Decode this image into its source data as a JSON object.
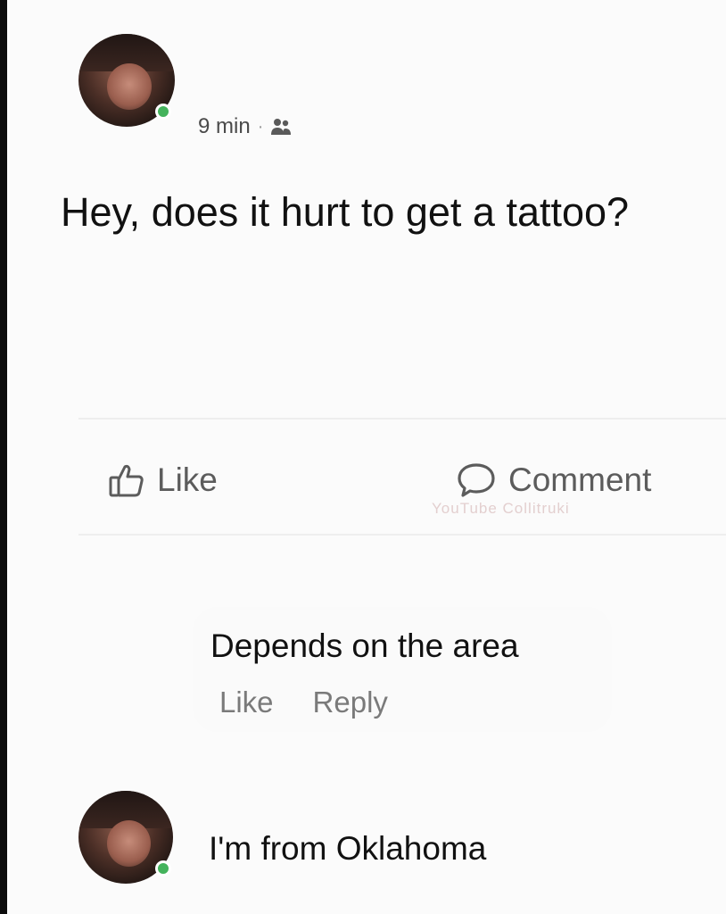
{
  "post": {
    "timestamp": "9 min",
    "separator": "·",
    "audience_icon": "friends-icon",
    "text": "Hey, does it hurt to get a tattoo?"
  },
  "actions": {
    "like_label": "Like",
    "comment_label": "Comment"
  },
  "watermark": "YouTube Collitruki",
  "comments": [
    {
      "text": "Depends on the area",
      "like_label": "Like",
      "reply_label": "Reply"
    },
    {
      "text": "I'm from Oklahoma"
    }
  ],
  "colors": {
    "online": "#44b35c",
    "text": "#111111",
    "secondary_text": "#5c5c5c"
  }
}
